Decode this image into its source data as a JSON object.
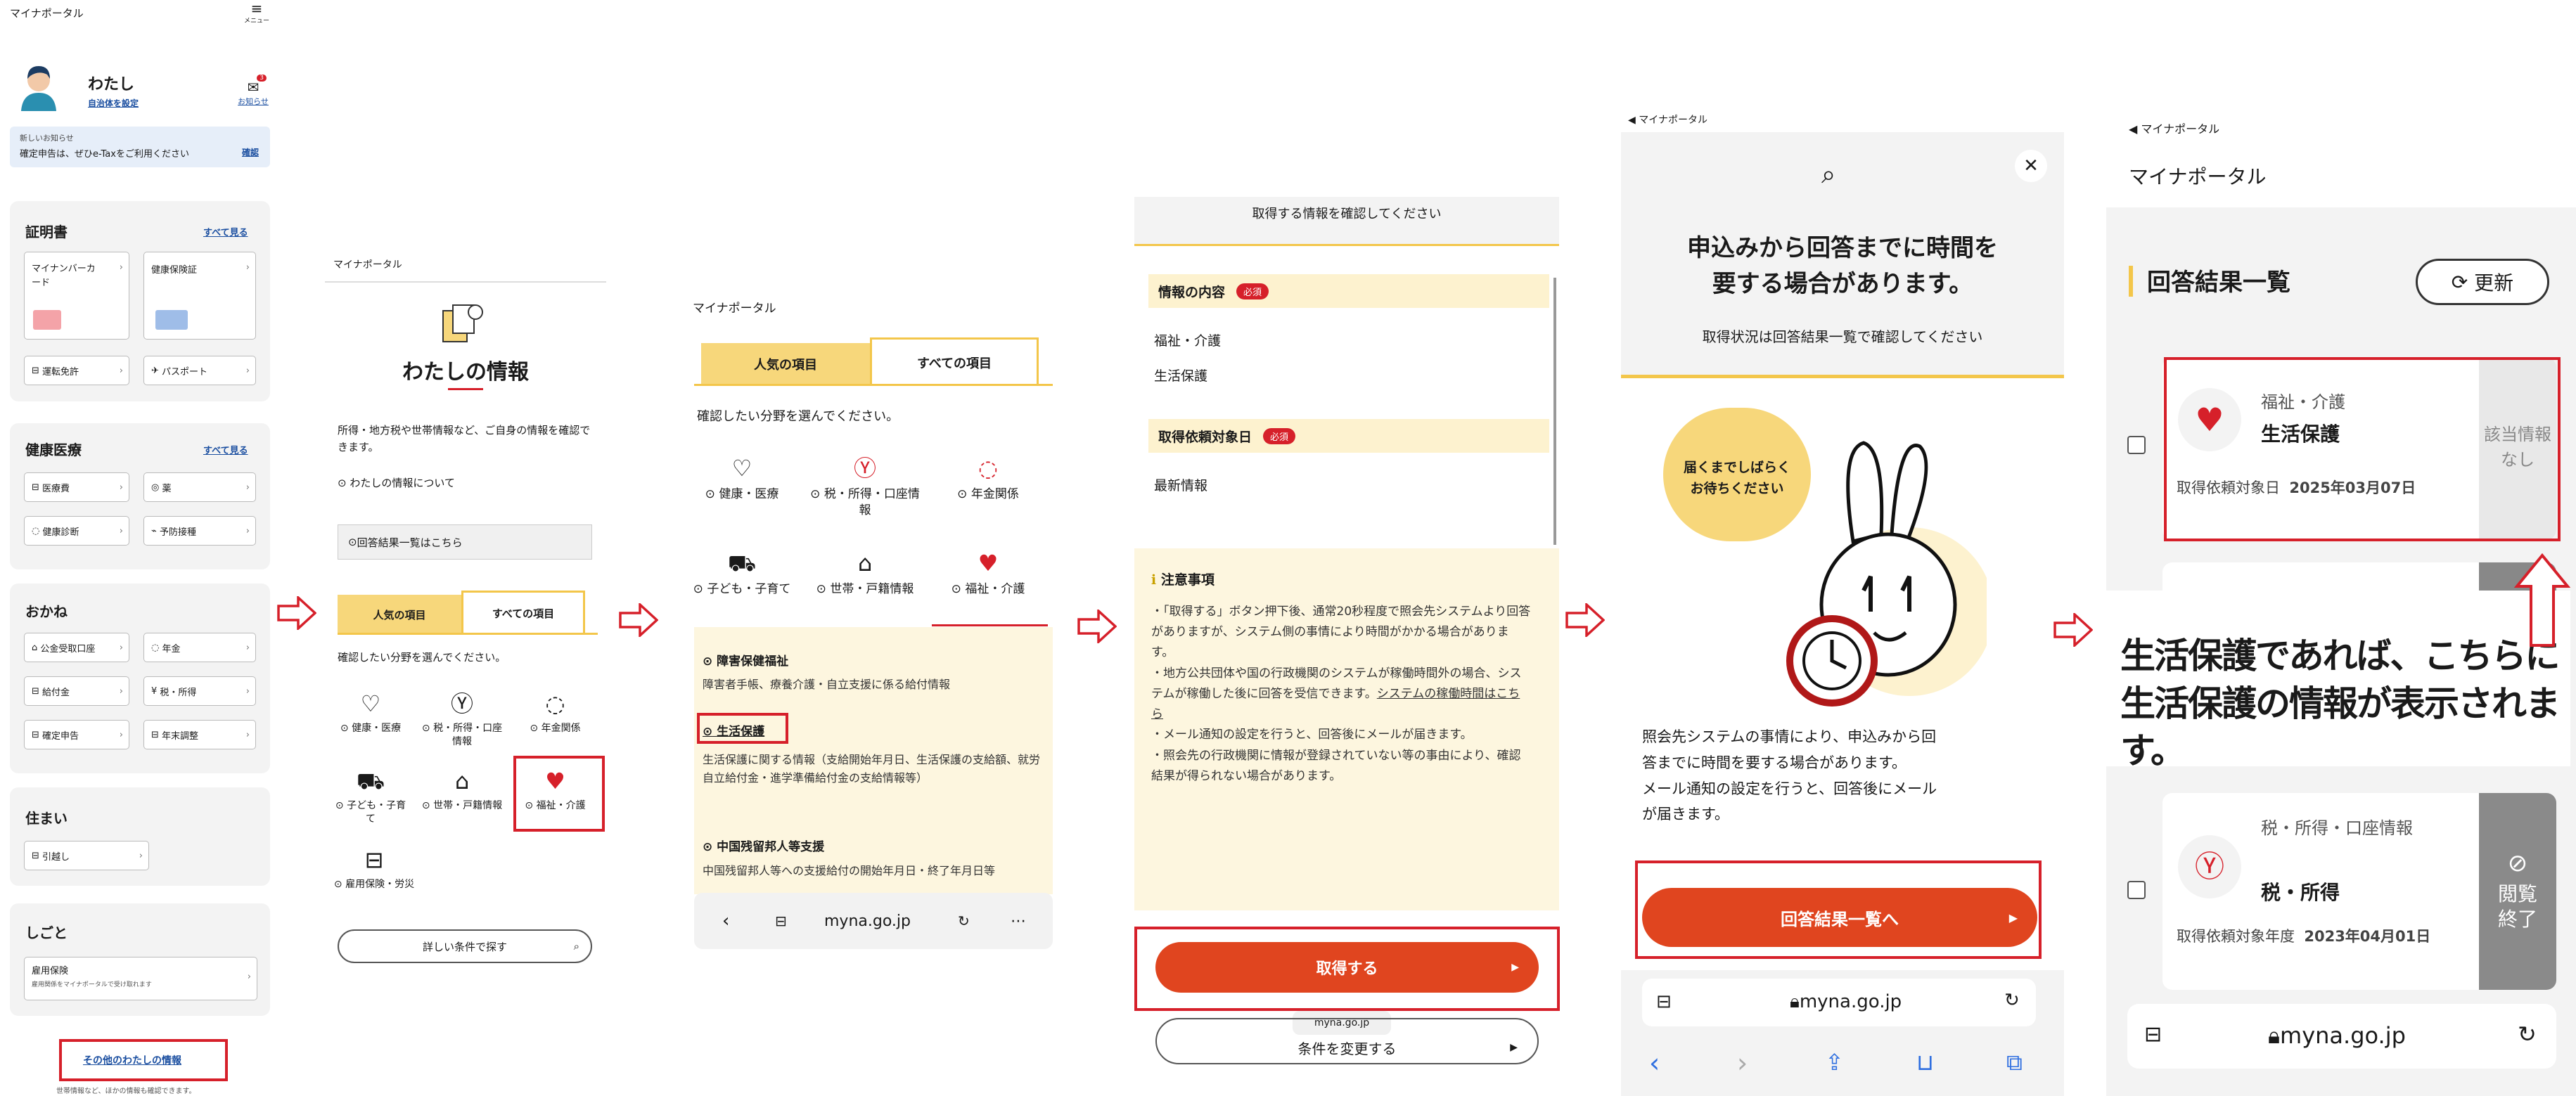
{
  "colors": {
    "accent_red": "#d6202a",
    "cta_red": "#e0451f",
    "yellow": "#f7d77b",
    "cream": "#fdf6df"
  },
  "p1": {
    "portal_title": "マイナポータル",
    "menu_label": "メニュー",
    "user_name": "わたし",
    "set_municipality": "自治体を設定",
    "notice_label": "お知らせ",
    "notice_count": "3",
    "new_notice_label": "新しいお知らせ",
    "new_notice_text": "確定申告は、ぜひe-Taxをご利用ください",
    "confirm_link": "確認",
    "sections": {
      "cert": {
        "title": "証明書",
        "more": "すべて見る"
      },
      "health": {
        "title": "健康医療",
        "more": "すべて見る"
      },
      "money": {
        "title": "おかね"
      },
      "home": {
        "title": "住まい"
      },
      "work": {
        "title": "しごと"
      }
    },
    "cert_items": [
      "マイナンバーカード",
      "健康保険証",
      "運転免許",
      "パスポート"
    ],
    "health_items": [
      "医療費",
      "薬",
      "健康診断",
      "予防接種"
    ],
    "money_items": [
      "公金受取口座",
      "年金",
      "給付金",
      "税・所得",
      "確定申告",
      "年末調整"
    ],
    "home_items": [
      "引越し"
    ],
    "work_item_title": "雇用保険",
    "work_item_sub": "雇用関係をマイナポータルで受け取れます",
    "other_info": "その他のわたしの情報",
    "other_info_sub": "世帯情報など、ほかの情報も確認できます。"
  },
  "p2": {
    "portal_title": "マイナポータル",
    "heading": "わたしの情報",
    "description": "所得・地方税や世帯情報など、ご自身の情報を確認できます。",
    "about_link": "わたしの情報について",
    "results_link": "回答結果一覧はこちら",
    "tab_popular": "人気の項目",
    "tab_all": "すべての項目",
    "choose_text": "確認したい分野を選んでください。",
    "categories": [
      "健康・医療",
      "税・所得・口座情報",
      "年金関係",
      "子ども・子育て",
      "世帯・戸籍情報",
      "福祉・介護",
      "雇用保険・労災"
    ],
    "search_btn": "詳しい条件で探す"
  },
  "p3": {
    "portal_title": "マイナポータル",
    "tab_popular": "人気の項目",
    "tab_all": "すべての項目",
    "choose_text": "確認したい分野を選んでください。",
    "categories": [
      "健康・医療",
      "税・所得・口座情報",
      "年金関係",
      "子ども・子育て",
      "世帯・戸籍情報",
      "福祉・介護"
    ],
    "items": [
      {
        "title": "障害保健福祉",
        "desc": "障害者手帳、療養介護・自立支援に係る給付情報"
      },
      {
        "title": "生活保護",
        "desc": "生活保護に関する情報（支給開始年月日、生活保護の支給額、就労自立給付金・進学準備給付金の支給情報等）"
      },
      {
        "title": "中国残留邦人等支援",
        "desc": "中国残留邦人等への支援給付の開始年月日・終了年月日等"
      }
    ],
    "url": "myna.go.jp"
  },
  "p4": {
    "top_text": "取得する情報を確認してください",
    "content_label": "情報の内容",
    "required": "必須",
    "content_values": [
      "福祉・介護",
      "生活保護"
    ],
    "date_label": "取得依頼対象日",
    "date_value": "最新情報",
    "notes_title": "注意事項",
    "notes": [
      "・「取得する」ボタン押下後、通常20秒程度で照会先システムより回答がありますが、システム側の事情により時間がかかる場合があります。",
      "・地方公共団体や国の行政機関のシステムが稼働時間外の場合、システムが稼働した後に回答を受信できます。",
      "・メール通知の設定を行うと、回答後にメールが届きます。",
      "・照会先の行政機関に情報が登録されていない等の事由により、確認結果が得られない場合があります。"
    ],
    "notes_link": "システムの稼働時間はこちら",
    "get_btn": "取得する",
    "url_small": "myna.go.jp",
    "change_btn": "条件を変更する"
  },
  "p5": {
    "portal_title": "マイナポータル",
    "heading_line1": "申込みから回答までに時間を",
    "heading_line2": "要する場合があります。",
    "subheading": "取得状況は回答結果一覧で確認してください",
    "bubble_line1": "届くまでしばらく",
    "bubble_line2": "お待ちください",
    "body_lines": [
      "照会先システムの事情により、申込みから回",
      "答までに時間を要する場合があります。",
      "メール通知の設定を行うと、回答後にメール",
      "が届きます。"
    ],
    "results_btn": "回答結果一覧へ",
    "url": "myna.go.jp"
  },
  "p6": {
    "portal_back": "マイナポータル",
    "portal_title": "マイナポータル",
    "heading": "回答結果一覧",
    "refresh": "更新",
    "card1": {
      "category": "福祉・介護",
      "title": "生活保護",
      "date_label": "取得依頼対象日",
      "date": "2025年03月07日",
      "status": "該当情報なし"
    },
    "overlay_line1": "生活保護であれば、こちらに",
    "overlay_line2": "生活保護の情報が表示されます。",
    "card2": {
      "category": "税・所得・口座情報",
      "title": "税・所得",
      "date_label": "取得依頼対象年度",
      "date": "2023年04月01日",
      "status": "閲覧終了"
    },
    "url": "myna.go.jp"
  }
}
